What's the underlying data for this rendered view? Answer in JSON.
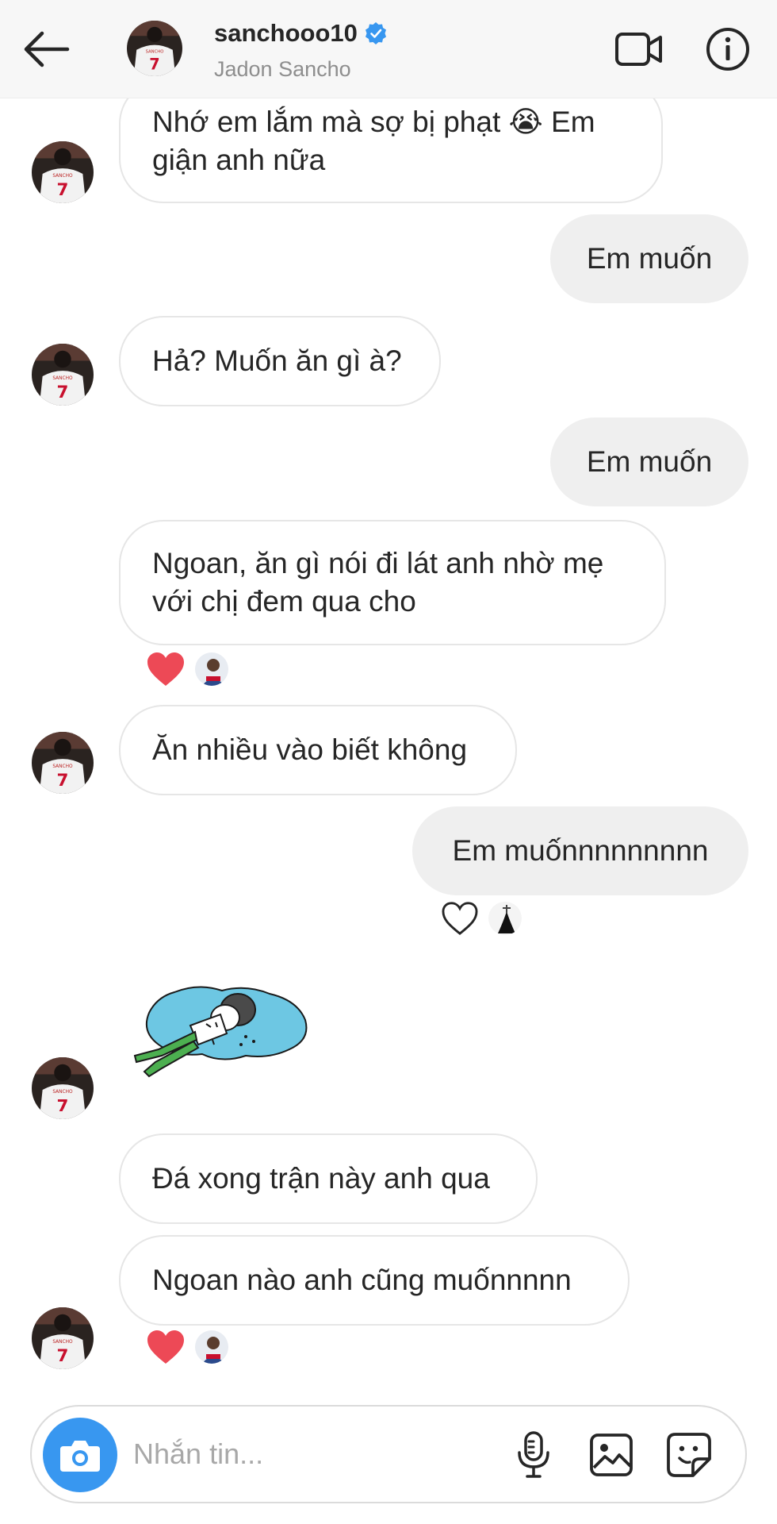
{
  "header": {
    "username": "sanchooo10",
    "full_name": "Jadon Sancho",
    "verified": true,
    "back_icon": "arrow-left-icon",
    "video_icon": "video-call-icon",
    "info_icon": "info-icon"
  },
  "avatar": {
    "jersey_name": "SANCHO",
    "jersey_number": "7"
  },
  "messages": [
    {
      "from": "them",
      "text_line1": "Nhớ em lắm mà sợ bị phạt 😭 Em",
      "text_line2": "giận anh nữa"
    },
    {
      "from": "me",
      "text": "Em muốn"
    },
    {
      "from": "them",
      "text": "Hả? Muốn ăn gì à?"
    },
    {
      "from": "me",
      "text": "Em muốn"
    },
    {
      "from": "them",
      "text_line1": "Ngoan, ăn gì nói đi lát anh nhờ mẹ",
      "text_line2": "với chị đem qua cho",
      "reaction": "heart-filled"
    },
    {
      "from": "them",
      "text": "Ăn nhiều vào biết không"
    },
    {
      "from": "me",
      "text": "Em muốnnnnnnnnn",
      "reaction": "heart-outline"
    },
    {
      "from": "them",
      "type": "sticker",
      "sticker": "person-lying-in-puddle-sticker"
    },
    {
      "from": "them",
      "text": "Đá xong trận này anh qua"
    },
    {
      "from": "them",
      "text": "Ngoan nào anh cũng muốnnnnn",
      "reaction": "heart-filled"
    }
  ],
  "composer": {
    "placeholder": "Nhắn tin...",
    "camera_icon": "camera-icon",
    "mic_icon": "microphone-icon",
    "gallery_icon": "image-icon",
    "sticker_icon": "sticker-icon"
  },
  "colors": {
    "accent": "#3897f0",
    "heart": "#ed4956",
    "verified": "#3897f0",
    "bubble_out": "#efefef",
    "bubble_in_border": "#e6e6e6"
  }
}
